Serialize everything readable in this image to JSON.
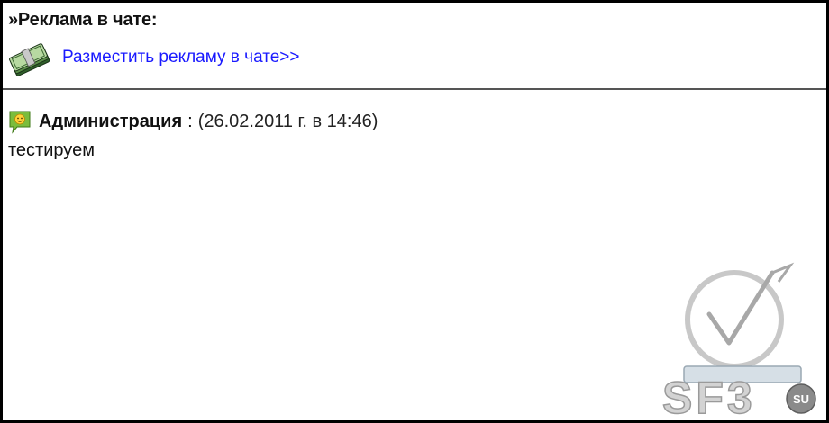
{
  "ad": {
    "header": "»Реклама в чате:",
    "link_label": "Разместить рекламу в чате>>"
  },
  "message": {
    "author": "Администрация",
    "separator": ":",
    "date": "(26.02.2011 г. в 14:46)",
    "text": "тестируем"
  },
  "watermark": {
    "text": "SF3",
    "suffix": "SU"
  },
  "icons": {
    "ad": "money-stack-icon",
    "message": "smiley-speech-icon"
  },
  "colors": {
    "link": "#1a1aff",
    "border": "#000000",
    "divider": "#555555"
  }
}
